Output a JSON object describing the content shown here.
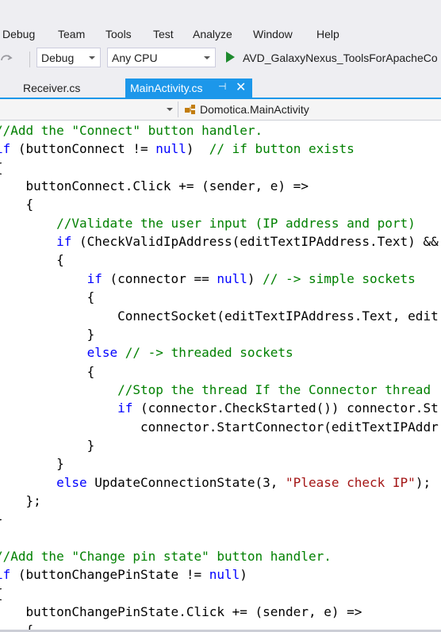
{
  "menu": [
    "Debug",
    "Team",
    "Tools",
    "Test",
    "Analyze",
    "Window",
    "Help"
  ],
  "toolbar": {
    "configuration": "Debug",
    "platform": "Any CPU",
    "run_target": "AVD_GalaxyNexus_ToolsForApacheCo"
  },
  "tabs": {
    "receiver": "Receiver.cs",
    "main": "MainActivity.cs",
    "pin_glyph": "⊣",
    "close_glyph": "✕"
  },
  "navbar": {
    "class_name": "Domotica.MainActivity"
  },
  "colors": {
    "keyword": "#0000ff",
    "comment": "#008000",
    "string": "#a31515",
    "accent": "#1c97ea"
  },
  "code": {
    "lines": [
      [
        {
          "t": "c",
          "v": "//Add the \"Connect\" button handler."
        }
      ],
      [
        {
          "t": "k",
          "v": "if"
        },
        {
          "t": "p",
          "v": " (buttonConnect != "
        },
        {
          "t": "k",
          "v": "null"
        },
        {
          "t": "p",
          "v": ")  "
        },
        {
          "t": "c",
          "v": "// if button exists"
        }
      ],
      [
        {
          "t": "p",
          "v": "{"
        }
      ],
      [
        {
          "t": "p",
          "v": "    buttonConnect.Click += (sender, e) =>"
        }
      ],
      [
        {
          "t": "p",
          "v": "    {"
        }
      ],
      [
        {
          "t": "p",
          "v": "        "
        },
        {
          "t": "c",
          "v": "//Validate the user input (IP address and port)"
        }
      ],
      [
        {
          "t": "p",
          "v": "        "
        },
        {
          "t": "k",
          "v": "if"
        },
        {
          "t": "p",
          "v": " (CheckValidIpAddress(editTextIPAddress.Text) &&"
        }
      ],
      [
        {
          "t": "p",
          "v": "        {"
        }
      ],
      [
        {
          "t": "p",
          "v": "            "
        },
        {
          "t": "k",
          "v": "if"
        },
        {
          "t": "p",
          "v": " (connector == "
        },
        {
          "t": "k",
          "v": "null"
        },
        {
          "t": "p",
          "v": ") "
        },
        {
          "t": "c",
          "v": "// -> simple sockets"
        }
      ],
      [
        {
          "t": "p",
          "v": "            {"
        }
      ],
      [
        {
          "t": "p",
          "v": "                ConnectSocket(editTextIPAddress.Text, edit"
        }
      ],
      [
        {
          "t": "p",
          "v": "            }"
        }
      ],
      [
        {
          "t": "p",
          "v": "            "
        },
        {
          "t": "k",
          "v": "else"
        },
        {
          "t": "p",
          "v": " "
        },
        {
          "t": "c",
          "v": "// -> threaded sockets"
        }
      ],
      [
        {
          "t": "p",
          "v": "            {"
        }
      ],
      [
        {
          "t": "p",
          "v": "                "
        },
        {
          "t": "c",
          "v": "//Stop the thread If the Connector thread"
        }
      ],
      [
        {
          "t": "p",
          "v": "                "
        },
        {
          "t": "k",
          "v": "if"
        },
        {
          "t": "p",
          "v": " (connector.CheckStarted()) connector.St"
        }
      ],
      [
        {
          "t": "p",
          "v": "                   connector.StartConnector(editTextIPAddr"
        }
      ],
      [
        {
          "t": "p",
          "v": "            }"
        }
      ],
      [
        {
          "t": "p",
          "v": "        }"
        }
      ],
      [
        {
          "t": "p",
          "v": "        "
        },
        {
          "t": "k",
          "v": "else"
        },
        {
          "t": "p",
          "v": " UpdateConnectionState(3, "
        },
        {
          "t": "s",
          "v": "\"Please check IP\""
        },
        {
          "t": "p",
          "v": ");"
        }
      ],
      [
        {
          "t": "p",
          "v": "    };"
        }
      ],
      [
        {
          "t": "p",
          "v": "}"
        }
      ],
      [
        {
          "t": "p",
          "v": ""
        }
      ],
      [
        {
          "t": "c",
          "v": "//Add the \"Change pin state\" button handler."
        }
      ],
      [
        {
          "t": "k",
          "v": "if"
        },
        {
          "t": "p",
          "v": " (buttonChangePinState != "
        },
        {
          "t": "k",
          "v": "null"
        },
        {
          "t": "p",
          "v": ")"
        }
      ],
      [
        {
          "t": "p",
          "v": "{"
        }
      ],
      [
        {
          "t": "p",
          "v": "    buttonChangePinState.Click += (sender, e) =>"
        }
      ],
      [
        {
          "t": "p",
          "v": "    {"
        }
      ]
    ]
  }
}
